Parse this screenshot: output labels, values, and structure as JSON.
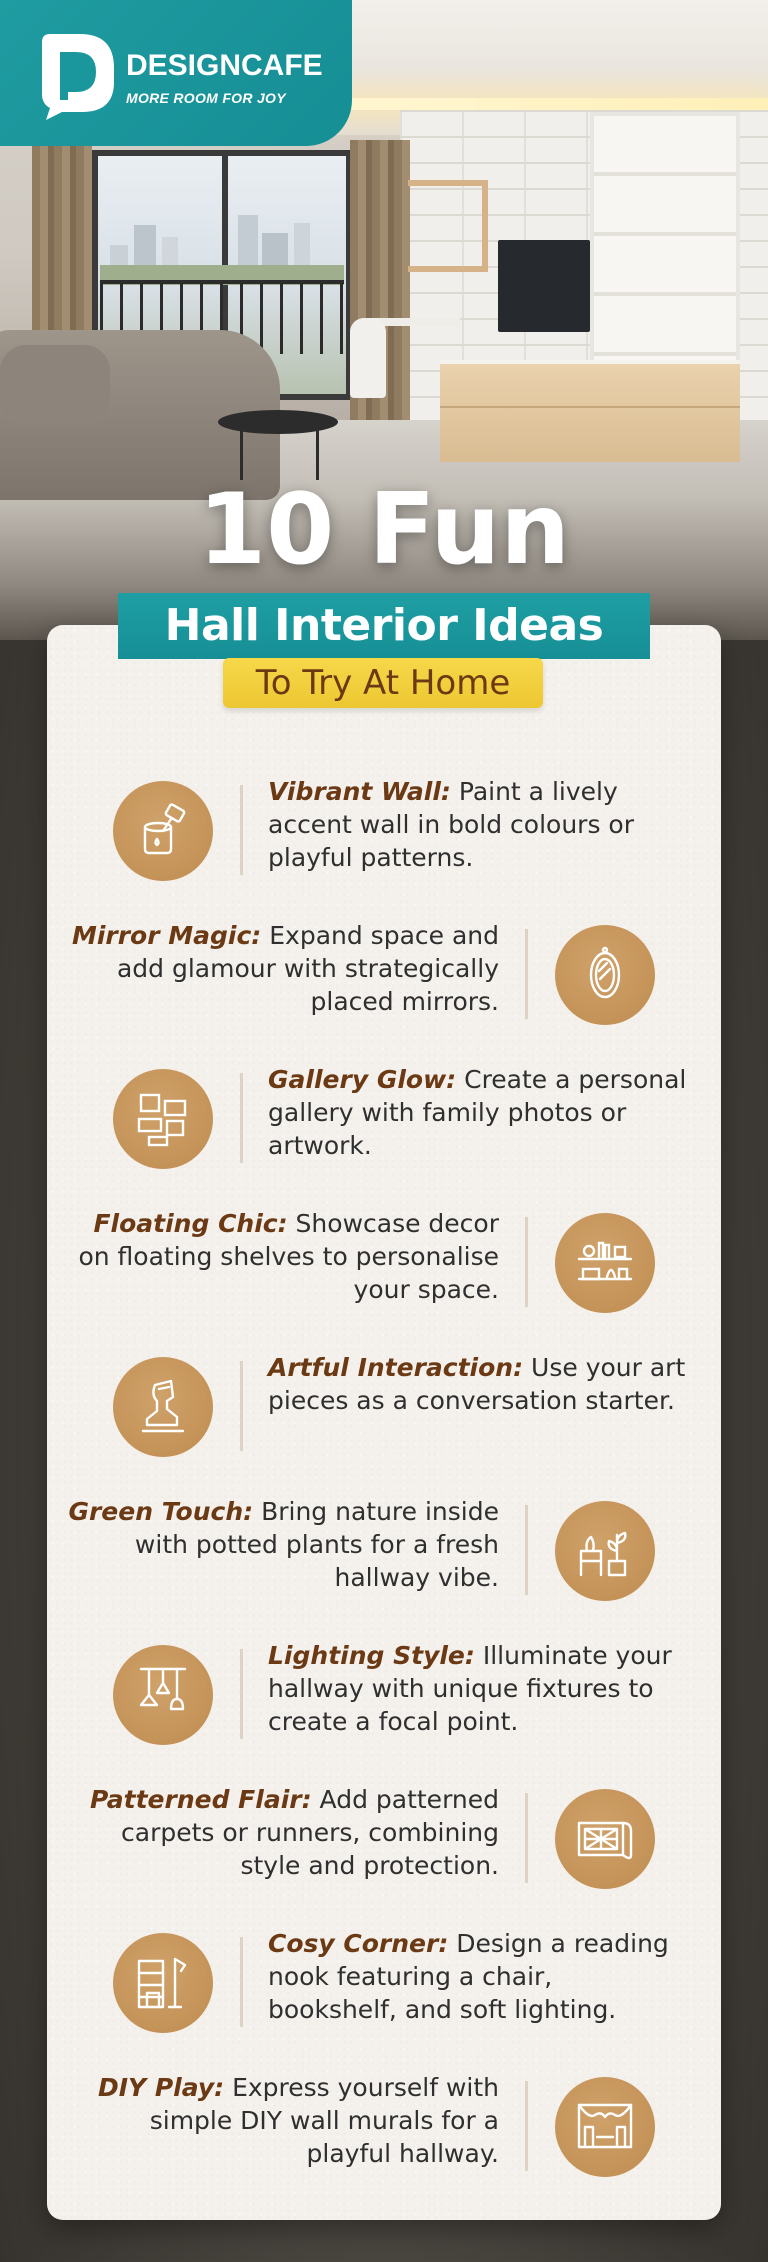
{
  "brand": {
    "name": "DESIGNCAFE",
    "tagline": "MORE ROOM FOR JOY",
    "colors": {
      "teal": "#1a979c",
      "gold": "#c4915a",
      "brown": "#6b3a14",
      "yellow": "#f2d03e"
    }
  },
  "header": {
    "title": "10 Fun",
    "subtitle": "Hall Interior Ideas",
    "tagline": "To Try At Home"
  },
  "ideas": [
    {
      "label": "Vibrant Wall:",
      "text": " Paint a lively accent wall in bold colours or playful patterns.",
      "icon": "paint-bucket-icon"
    },
    {
      "label": "Mirror Magic:",
      "text": " Expand space and add glamour with strategically placed mirrors.",
      "icon": "mirror-icon"
    },
    {
      "label": "Gallery Glow:",
      "text": " Create a personal gallery with family photos or artwork.",
      "icon": "gallery-frames-icon"
    },
    {
      "label": "Floating Chic:",
      "text": " Showcase decor on floating shelves to personalise your space.",
      "icon": "floating-shelf-icon"
    },
    {
      "label": "Artful Interaction:",
      "text": " Use your art pieces as a conversation starter.",
      "icon": "bust-sculpture-icon"
    },
    {
      "label": "Green Touch:",
      "text": " Bring nature inside with potted plants for a fresh hallway vibe.",
      "icon": "potted-plant-icon"
    },
    {
      "label": "Lighting Style:",
      "text": " Illuminate your hallway with unique fixtures to create a focal point.",
      "icon": "pendant-lights-icon"
    },
    {
      "label": "Patterned Flair:",
      "text": " Add patterned carpets or runners, combining style and protection.",
      "icon": "carpet-runner-icon"
    },
    {
      "label": "Cosy Corner:",
      "text": " Design a reading nook featuring a chair, bookshelf, and soft lighting.",
      "icon": "reading-nook-icon"
    },
    {
      "label": "DIY Play:",
      "text": " Express yourself with simple DIY wall murals for a playful hallway.",
      "icon": "wall-mural-icon"
    }
  ]
}
